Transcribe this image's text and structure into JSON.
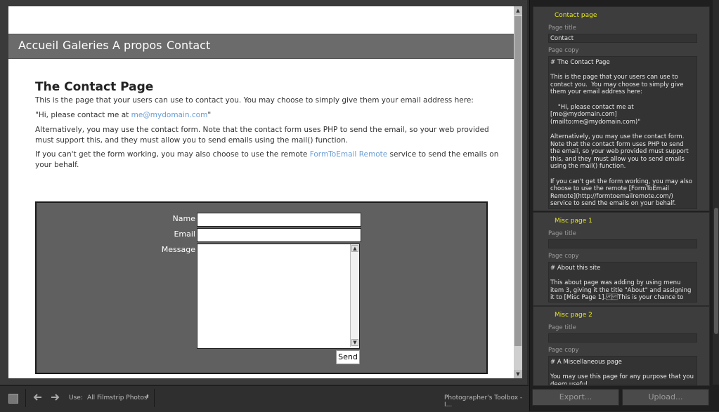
{
  "preview": {
    "nav": [
      "Accueil",
      "Galeries",
      "A propos",
      "Contact"
    ],
    "heading": "The Contact Page",
    "para1": "This is the page that your users can use to contact you. You may choose to simply give them your email address here:",
    "para2_prefix": "\"Hi, please contact me at ",
    "para2_link": "me@mydomain.com",
    "para2_suffix": "\"",
    "para3": "Alternatively, you may use the contact form. Note that the contact form uses PHP to send the email, so your web provided must support this, and they must allow you to send emails using the mail() function.",
    "para4_prefix": "If you can't get the form working, you may also choose to use the remote ",
    "para4_link": "FormToEmail Remote",
    "para4_suffix": " service to send the emails on your behalf.",
    "form": {
      "name_label": "Name",
      "email_label": "Email",
      "message_label": "Message",
      "name_value": "",
      "email_value": "",
      "message_value": "",
      "send_label": "Send"
    }
  },
  "toolbar": {
    "use_label": "Use:",
    "use_value": "All Filmstrip Photos",
    "plugin_label": "Photographer's Toolbox - I..."
  },
  "panel": {
    "sections": [
      {
        "title": "Contact page",
        "page_title_label": "Page title",
        "page_title_value": "Contact",
        "page_copy_label": "Page copy",
        "page_copy_value": "# The Contact Page\n\nThis is the page that your users can use to contact you.  You may choose to simply give them your email address here:\n\n    \"Hi, please contact me at [me@mydomain.com](mailto:me@mydomain.com)\"\n\nAlternatively, you may use the contact form.  Note that the contact form uses PHP to send the email, so your web provided must support this, and they must allow you to send emails using the mail() function.\n\nIf you can't get the form working, you may also choose to use the remote [FormToEmail Remote](http://formtoemailremote.com/) service to send the emails on your behalf."
      },
      {
        "title": "Misc page 1",
        "page_title_label": "Page title",
        "page_title_value": "",
        "page_copy_label": "Page copy",
        "page_copy_value": "# About this site\n\nThis about page was adding by using menu item 3, giving it the title \"About\" and assigning it to [Misc Page 1].\u000b\u000bThis is your chance to talk about yourself!"
      },
      {
        "title": "Misc page 2",
        "page_title_label": "Page title",
        "page_title_value": "",
        "page_copy_label": "Page copy",
        "page_copy_value": "# A Miscellaneous page\n\nYou may use this page for any purpose that you deem useful."
      }
    ],
    "export_label": "Export...",
    "upload_label": "Upload..."
  }
}
